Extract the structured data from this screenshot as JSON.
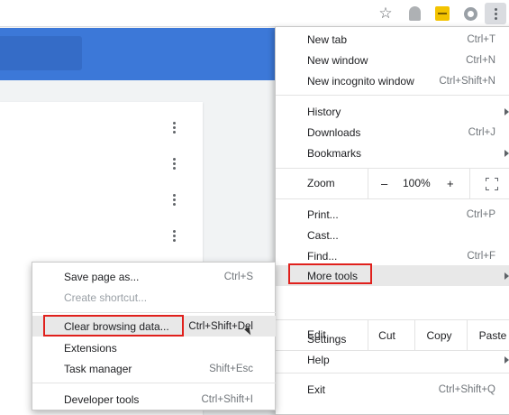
{
  "toolbar": {
    "icons": [
      "star-icon",
      "ghost-extension-icon",
      "yellow-extension-icon",
      "circle-extension-icon",
      "kebab-menu-icon"
    ]
  },
  "menu": {
    "group1": [
      {
        "label": "New tab",
        "shortcut": "Ctrl+T"
      },
      {
        "label": "New window",
        "shortcut": "Ctrl+N"
      },
      {
        "label": "New incognito window",
        "shortcut": "Ctrl+Shift+N"
      }
    ],
    "group2": [
      {
        "label": "History",
        "shortcut": ""
      },
      {
        "label": "Downloads",
        "shortcut": "Ctrl+J"
      },
      {
        "label": "Bookmarks",
        "shortcut": ""
      }
    ],
    "zoom": {
      "label": "Zoom",
      "minus": "–",
      "value": "100%",
      "plus": "+"
    },
    "group3": [
      {
        "label": "Print...",
        "shortcut": "Ctrl+P"
      },
      {
        "label": "Cast...",
        "shortcut": ""
      },
      {
        "label": "Find...",
        "shortcut": "Ctrl+F"
      },
      {
        "label": "More tools",
        "shortcut": ""
      }
    ],
    "edit": {
      "label": "Edit",
      "cut": "Cut",
      "copy": "Copy",
      "paste": "Paste"
    },
    "group4": [
      {
        "label": "Settings",
        "shortcut": ""
      },
      {
        "label": "Help",
        "shortcut": ""
      }
    ],
    "exit": {
      "label": "Exit",
      "shortcut": "Ctrl+Shift+Q"
    }
  },
  "submenu": {
    "items": [
      {
        "label": "Save page as...",
        "shortcut": "Ctrl+S"
      },
      {
        "label": "Create shortcut...",
        "shortcut": ""
      },
      {
        "label": "Clear browsing data...",
        "shortcut": "Ctrl+Shift+Del"
      },
      {
        "label": "Extensions",
        "shortcut": ""
      },
      {
        "label": "Task manager",
        "shortcut": "Shift+Esc"
      },
      {
        "label": "Developer tools",
        "shortcut": "Ctrl+Shift+I"
      }
    ]
  },
  "colors": {
    "highlight_box": "#e0201c",
    "page_accent": "#3c78d8"
  }
}
